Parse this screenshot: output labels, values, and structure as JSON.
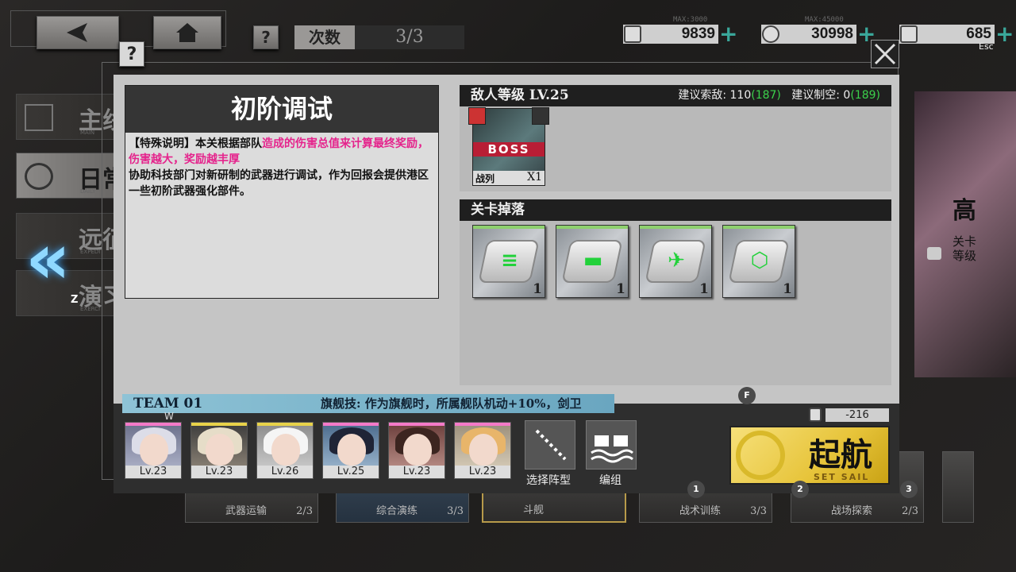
{
  "topbar": {
    "runs_label": "次数",
    "runs_value": "3/3",
    "resources": [
      {
        "icon": "oil-icon",
        "max": "MAX:3000",
        "value": "9839"
      },
      {
        "icon": "coin-icon",
        "max": "MAX:45000",
        "value": "30998"
      },
      {
        "icon": "gem-icon",
        "max": "",
        "value": "685"
      }
    ],
    "esc_label": "Esc"
  },
  "sidebar": {
    "items": [
      {
        "label": "主线",
        "sub": "MAIN"
      },
      {
        "label": "日常",
        "sub": "DAILY"
      },
      {
        "label": "远征",
        "sub": "EXPEDI"
      },
      {
        "label": "演习",
        "sub": "EXERCI"
      }
    ],
    "back_hotkey": "Z"
  },
  "modal": {
    "title": "初阶调试",
    "special_prefix": "【特殊说明】本关根据部队",
    "special_highlight": "造成的伤害总值来计算最终奖励，伤害越大，奖励越丰厚",
    "description": "协助科技部门对新研制的武器进行调试，作为回报会提供港区一些初阶武器强化部件。",
    "enemy_level": "敌人等级 LV.25",
    "recommend_recon_label": "建议索敌: 110",
    "recommend_recon_value": "(187)",
    "recommend_air_label": "建议制空: 0",
    "recommend_air_value": "(189)",
    "enemy": {
      "badge": "BOSS",
      "type": "战列",
      "count": "X1"
    },
    "drops_label": "关卡掉落",
    "drops": [
      {
        "icon": "plate-gun-icon",
        "count": "1"
      },
      {
        "icon": "plate-torpedo-icon",
        "count": "1"
      },
      {
        "icon": "plate-aircraft-icon",
        "count": "1"
      },
      {
        "icon": "plate-auxiliary-icon",
        "count": "1"
      }
    ]
  },
  "team": {
    "label": "TEAM 01",
    "skill": "旗舰技: 作为旗舰时，所属舰队机动+10%，剑卫",
    "flag_hotkey": "W",
    "ships": [
      {
        "level": "Lv.23",
        "rarity": "#f47ac8"
      },
      {
        "level": "Lv.23",
        "rarity": "#e8d24a"
      },
      {
        "level": "Lv.26",
        "rarity": "#e8d24a"
      },
      {
        "level": "Lv.25",
        "rarity": "#f47ac8"
      },
      {
        "level": "Lv.23",
        "rarity": "#f47ac8"
      },
      {
        "level": "Lv.23",
        "rarity": "#f47ac8"
      }
    ],
    "formation_label": "选择阵型",
    "fleet_label": "编组",
    "oil_cost": "-216",
    "sail_label": "起航",
    "sail_sub": "SET SAIL",
    "hotkeys": {
      "f": "F",
      "k1": "1",
      "k2": "2",
      "k3": "3"
    }
  },
  "background_stages": [
    {
      "name": "武器运输",
      "count": "2/3"
    },
    {
      "name": "综合演练",
      "count": "3/3"
    },
    {
      "name": "斗舰",
      "count": ""
    },
    {
      "name": "战术训练",
      "count": "3/3"
    },
    {
      "name": "战场探索",
      "count": "2/3"
    }
  ],
  "right_panel": {
    "title": "高",
    "line1": "关卡",
    "line2": "等级"
  }
}
